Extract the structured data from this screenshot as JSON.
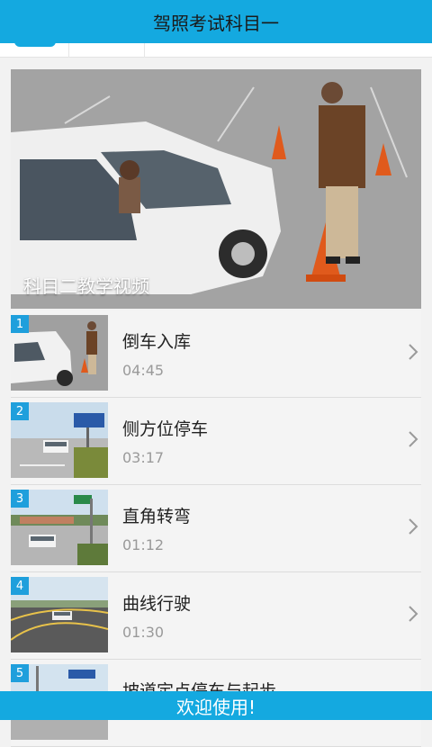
{
  "app": {
    "title": "驾照考试科目一"
  },
  "hero": {
    "caption": "科目二教学视频"
  },
  "videos": [
    {
      "index": "1",
      "title": "倒车入库",
      "duration": "04:45"
    },
    {
      "index": "2",
      "title": "侧方位停车",
      "duration": "03:17"
    },
    {
      "index": "3",
      "title": "直角转弯",
      "duration": "01:12"
    },
    {
      "index": "4",
      "title": "曲线行驶",
      "duration": "01:30"
    },
    {
      "index": "5",
      "title": "坡道定点停车与起步",
      "duration": ""
    }
  ],
  "footer": {
    "text": "欢迎使用!"
  },
  "colors": {
    "accent": "#14a9e0",
    "badge": "#1f9fdc"
  }
}
